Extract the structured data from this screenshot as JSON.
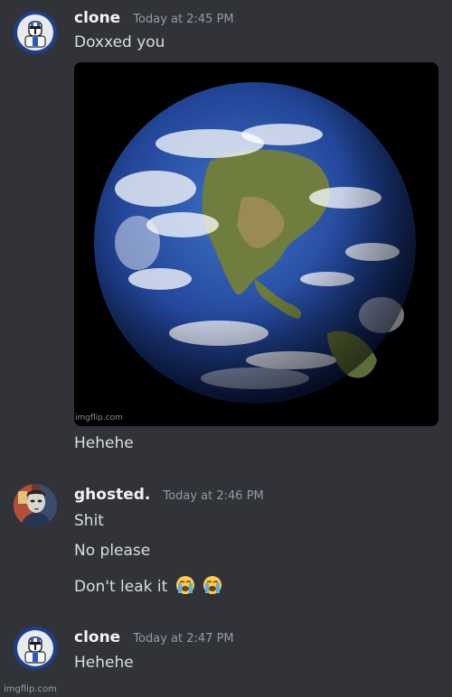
{
  "messages": [
    {
      "username": "clone",
      "timestamp": "Today at 2:45 PM",
      "lines": [
        "Doxxed you"
      ],
      "attachment_credit": "imgflip.com",
      "after_lines": [
        "Hehehe"
      ]
    },
    {
      "username": "ghosted.",
      "timestamp": "Today at 2:46 PM",
      "lines": [
        "Shit",
        "No please",
        "Don't leak it"
      ]
    },
    {
      "username": "clone",
      "timestamp": "Today at 2:47 PM",
      "lines": [
        "Hehehe"
      ]
    }
  ],
  "footer": {
    "credit": "imgflip.com"
  },
  "colors": {
    "background": "#313338",
    "username": "#f2f3f5",
    "timestamp": "#949ba4",
    "text": "#dbdee1"
  },
  "icons": [
    "clone-trooper-avatar-icon",
    "ghost-mask-avatar-icon",
    "loudly-crying-emoji-icon"
  ]
}
